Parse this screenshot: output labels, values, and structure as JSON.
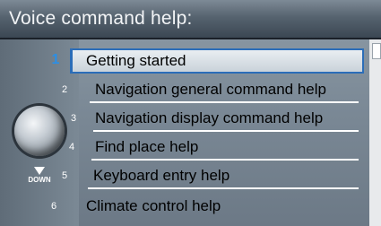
{
  "screen": {
    "title": "Voice command help:"
  },
  "menu": {
    "items": [
      {
        "number": "1",
        "label": "Getting started",
        "selected": true
      },
      {
        "number": "2",
        "label": "Navigation general command help",
        "selected": false
      },
      {
        "number": "3",
        "label": "Navigation display command help",
        "selected": false
      },
      {
        "number": "4",
        "label": "Find place help",
        "selected": false
      },
      {
        "number": "5",
        "label": "Keyboard entry help",
        "selected": false
      },
      {
        "number": "6",
        "label": "Climate control help",
        "selected": false
      }
    ]
  },
  "controls": {
    "knob_icon": "rotary-knob-icon",
    "down_icon": "down-arrow-icon",
    "down_label": "DOWN"
  },
  "colors": {
    "selection_border": "#2b6db8",
    "selected_number": "#2b8fe6"
  }
}
